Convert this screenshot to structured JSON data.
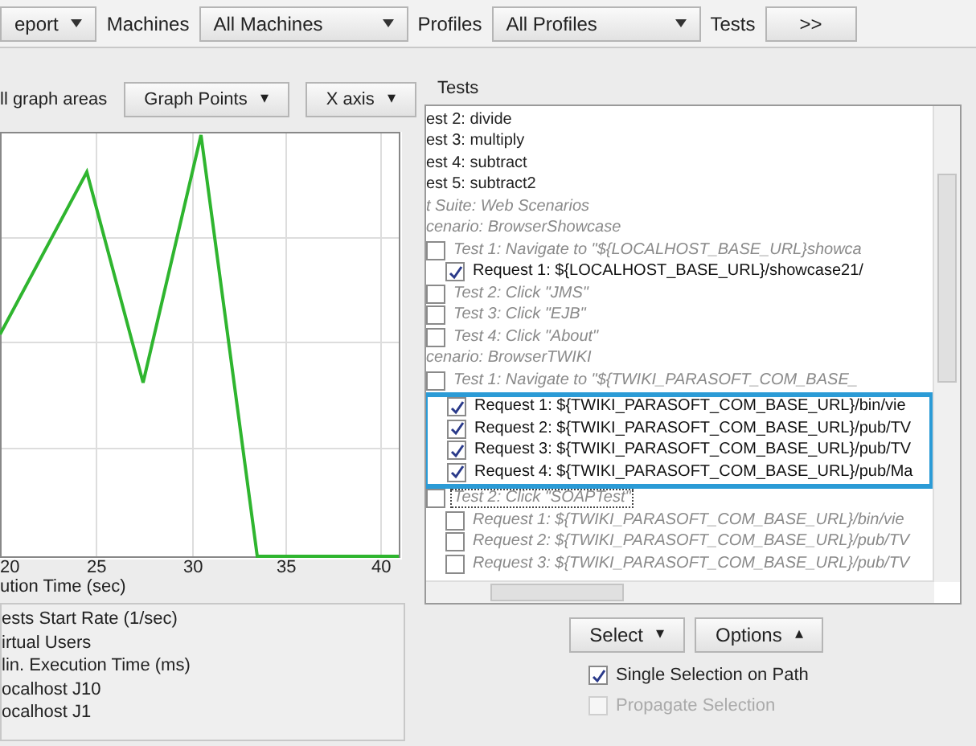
{
  "toolbar": {
    "items": [
      {
        "kind": "dropdown",
        "label": "eport"
      },
      {
        "kind": "label",
        "label": "Machines"
      },
      {
        "kind": "dropdown",
        "label": "All Machines"
      },
      {
        "kind": "label",
        "label": "Profiles"
      },
      {
        "kind": "dropdown",
        "label": "All Profiles"
      },
      {
        "kind": "label",
        "label": "Tests"
      },
      {
        "kind": "button",
        "label": ">>"
      }
    ]
  },
  "graph": {
    "caption": "ll graph areas",
    "buttons": [
      {
        "label": "Graph Points",
        "caret": "▾"
      },
      {
        "label": "X axis",
        "caret": "▾"
      }
    ],
    "x_ticks": [
      "20",
      "25",
      "30",
      "35",
      "40"
    ],
    "x_axis_label": "ution Time (sec)",
    "legend": [
      "ests Start Rate (1/sec)",
      "irtual Users",
      "lin. Execution Time (ms)",
      "ocalhost J10",
      "ocalhost J1"
    ]
  },
  "tests": {
    "title": "Tests",
    "tree": [
      {
        "kind": "test",
        "label": "est 2: divide"
      },
      {
        "kind": "test",
        "label": "est 3: multiply"
      },
      {
        "kind": "test",
        "label": "est 4: subtract"
      },
      {
        "kind": "test",
        "label": "est 5: subtract2"
      },
      {
        "kind": "group",
        "label": "t Suite: Web Scenarios",
        "children": [
          {
            "kind": "group",
            "label": "cenario: BrowserShowcase",
            "children": [
              {
                "kind": "check",
                "label": "Test 1: Navigate to \"${LOCALHOST_BASE_URL}showca",
                "checked": false,
                "highlighted": false,
                "focused": false,
                "children": [
                  {
                    "kind": "check",
                    "label": "Request 1: ${LOCALHOST_BASE_URL}/showcase21/",
                    "checked": true,
                    "highlighted": false,
                    "focused": false
                  }
                ]
              },
              {
                "kind": "check",
                "label": "Test 2: Click \"JMS\"",
                "checked": false,
                "highlighted": false,
                "focused": false
              },
              {
                "kind": "check",
                "label": "Test 3: Click \"EJB\"",
                "checked": false,
                "highlighted": false,
                "focused": false
              },
              {
                "kind": "check",
                "label": "Test 4: Click \"About\"",
                "checked": false,
                "highlighted": false,
                "focused": false
              }
            ]
          },
          {
            "kind": "group",
            "label": "cenario: BrowserTWIKI",
            "children": [
              {
                "kind": "check",
                "label": "Test 1: Navigate to \"${TWIKI_PARASOFT_COM_BASE_",
                "checked": false,
                "highlighted": true,
                "focused": false,
                "children": [
                  {
                    "kind": "check",
                    "label": "Request 1: ${TWIKI_PARASOFT_COM_BASE_URL}/bin/vie",
                    "checked": true,
                    "highlighted": false,
                    "focused": false
                  },
                  {
                    "kind": "check",
                    "label": "Request 2: ${TWIKI_PARASOFT_COM_BASE_URL}/pub/TV",
                    "checked": true,
                    "highlighted": false,
                    "focused": false
                  },
                  {
                    "kind": "check",
                    "label": "Request 3: ${TWIKI_PARASOFT_COM_BASE_URL}/pub/TV",
                    "checked": true,
                    "highlighted": false,
                    "focused": false
                  },
                  {
                    "kind": "check",
                    "label": "Request 4: ${TWIKI_PARASOFT_COM_BASE_URL}/pub/Ma",
                    "checked": true,
                    "highlighted": false,
                    "focused": false
                  }
                ]
              },
              {
                "kind": "check",
                "label": "Test 2: Click \"SOAPTest\"",
                "checked": false,
                "highlighted": false,
                "focused": true,
                "children": [
                  {
                    "kind": "check",
                    "label": "Request 1: ${TWIKI_PARASOFT_COM_BASE_URL}/bin/vie",
                    "checked": false,
                    "highlighted": false,
                    "focused": false
                  },
                  {
                    "kind": "check",
                    "label": "Request 2: ${TWIKI_PARASOFT_COM_BASE_URL}/pub/TV",
                    "checked": false,
                    "highlighted": false,
                    "focused": false
                  },
                  {
                    "kind": "check",
                    "label": "Request 3: ${TWIKI_PARASOFT_COM_BASE_URL}/pub/TV",
                    "checked": false,
                    "highlighted": false,
                    "focused": false
                  }
                ]
              }
            ]
          }
        ]
      }
    ],
    "buttons": [
      {
        "label": "Select",
        "caret": "▾"
      },
      {
        "label": "Options",
        "caret": "▴"
      }
    ],
    "options": [
      {
        "label": "Single Selection on Path",
        "checked": true,
        "disabled": false
      },
      {
        "label": "Propagate Selection",
        "checked": false,
        "disabled": true
      }
    ]
  }
}
